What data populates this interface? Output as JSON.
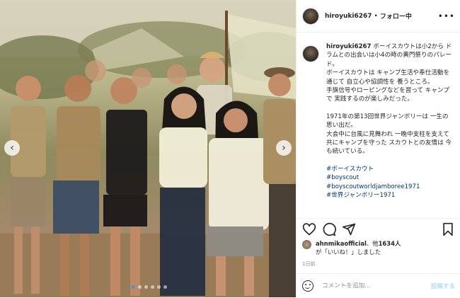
{
  "post": {
    "username": "hiroyuki6267",
    "separator": "•",
    "follow_state": "フォロー中",
    "caption": {
      "username": "hiroyuki6267",
      "paragraphs": [
        "ボーイスカウトは小2から ドラムとの出会いは小4の時の黄門祭りのパレード。\nボーイスカウトは キャンプ生活や奉仕活動を通じて 自立心や協調性を 養うところ。\n手旗信号やローピングなどを習って キャンプで 実践するのが楽しみだった。",
        "1971年の第13回世界ジャンボリーは 一生の思い出だ。\n大会中に台風に見舞われ 一晩中支柱を支えて共にキャンプを守った スカウトとの友情は 今も続いている。"
      ],
      "hashtags": [
        "#ボーイスカウト",
        "#boyscout",
        "#boyscoutworldjamboree1971",
        "#世界ジャンボリー1971"
      ]
    },
    "likes": {
      "user": "ahnmikaofficial",
      "middle": "、他",
      "count": "1634人",
      "line2": "が「いいね！」しました"
    },
    "time": "1日前",
    "comment": {
      "placeholder": "コメントを追加...",
      "post_label": "投稿する"
    },
    "icons": [
      "heart-icon",
      "comment-icon",
      "share-icon",
      "bookmark-icon",
      "emoji-icon",
      "more-icon"
    ],
    "carousel": {
      "total": 6,
      "active": 1
    },
    "colors": {
      "link": "#00376b",
      "post_disabled": "#b2dffc",
      "active_dot": "#3897f0"
    }
  }
}
